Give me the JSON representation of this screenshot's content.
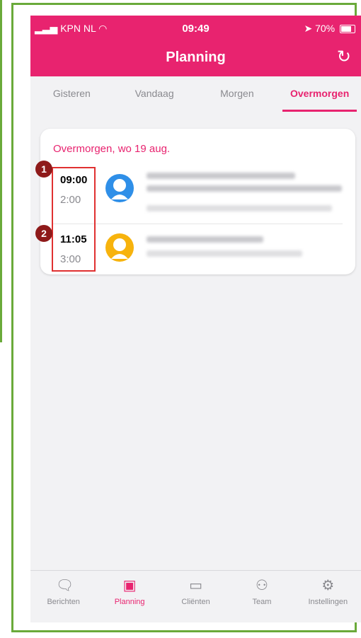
{
  "status_bar": {
    "carrier": "KPN NL",
    "time": "09:49",
    "battery": "70%"
  },
  "header": {
    "title": "Planning"
  },
  "tabs": [
    {
      "label": "Gisteren"
    },
    {
      "label": "Vandaag"
    },
    {
      "label": "Morgen"
    },
    {
      "label": "Overmorgen",
      "active": true
    }
  ],
  "card": {
    "date_heading": "Overmorgen, wo 19 aug.",
    "appointments": [
      {
        "time": "09:00",
        "duration": "2:00",
        "avatar_color": "#2f8fe8",
        "avatar_icon": "person-female-icon"
      },
      {
        "time": "11:05",
        "duration": "3:00",
        "avatar_color": "#f7b30d",
        "avatar_icon": "person-male-icon"
      }
    ]
  },
  "markers": [
    "1",
    "2"
  ],
  "bottom_nav": [
    {
      "label": "Berichten",
      "icon": "chat-icon"
    },
    {
      "label": "Planning",
      "icon": "calendar-icon",
      "active": true
    },
    {
      "label": "Cliënten",
      "icon": "id-card-icon"
    },
    {
      "label": "Team",
      "icon": "team-icon"
    },
    {
      "label": "Instellingen",
      "icon": "gear-icon"
    }
  ],
  "colors": {
    "brand": "#e8236f",
    "frame": "#6aaa3a",
    "highlight": "#e03030",
    "marker": "#8e1a1a"
  }
}
